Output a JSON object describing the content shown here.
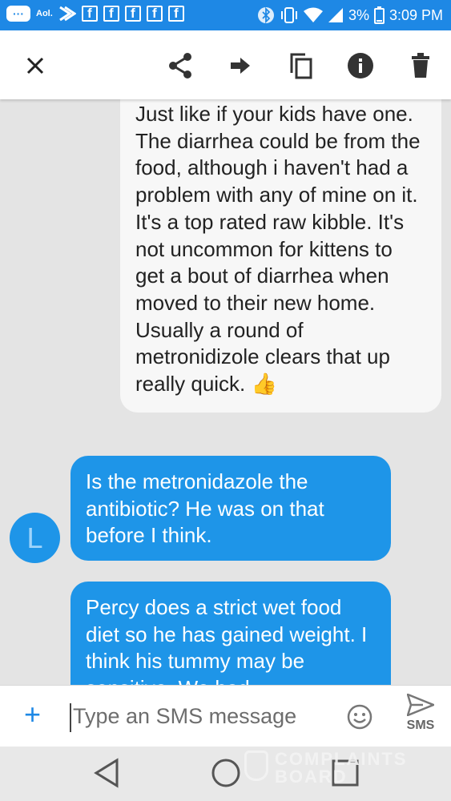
{
  "status_bar": {
    "aol_label": "Aol.",
    "fb_icons": [
      "f",
      "f",
      "f",
      "f",
      "f"
    ],
    "battery": "3%",
    "time": "3:09 PM"
  },
  "toolbar": {
    "close_icon": "close-icon",
    "share_icon": "share-icon",
    "forward_icon": "forward-arrow-icon",
    "copy_icon": "copy-icon",
    "info_icon": "info-icon",
    "delete_icon": "trash-icon"
  },
  "messages": [
    {
      "direction": "incoming",
      "text": "Just like if your kids have one. The diarrhea could be from the food, although i haven't had a problem with any of mine on it. It's a top rated raw kibble. It's not uncommon for kittens to get a bout of diarrhea when moved to their new home. Usually a round of metronidizole clears that up really quick.",
      "emoji": "👍"
    },
    {
      "direction": "outgoing",
      "text": "Is the metronidazole the antibiotic? He was on that before I think."
    },
    {
      "direction": "outgoing",
      "text": "Percy does a strict wet food diet so he has gained weight. I think his tummy may be sensitive. We had"
    }
  ],
  "avatar": {
    "initial": "L"
  },
  "composer": {
    "placeholder": "Type an SMS message",
    "send_label": "SMS"
  },
  "watermark": {
    "line1": "COMPLAINTS",
    "line2": "BOARD"
  },
  "colors": {
    "accent": "#1e88e5",
    "outgoing_bubble": "#1e95e8",
    "incoming_bubble": "#f7f7f7"
  }
}
